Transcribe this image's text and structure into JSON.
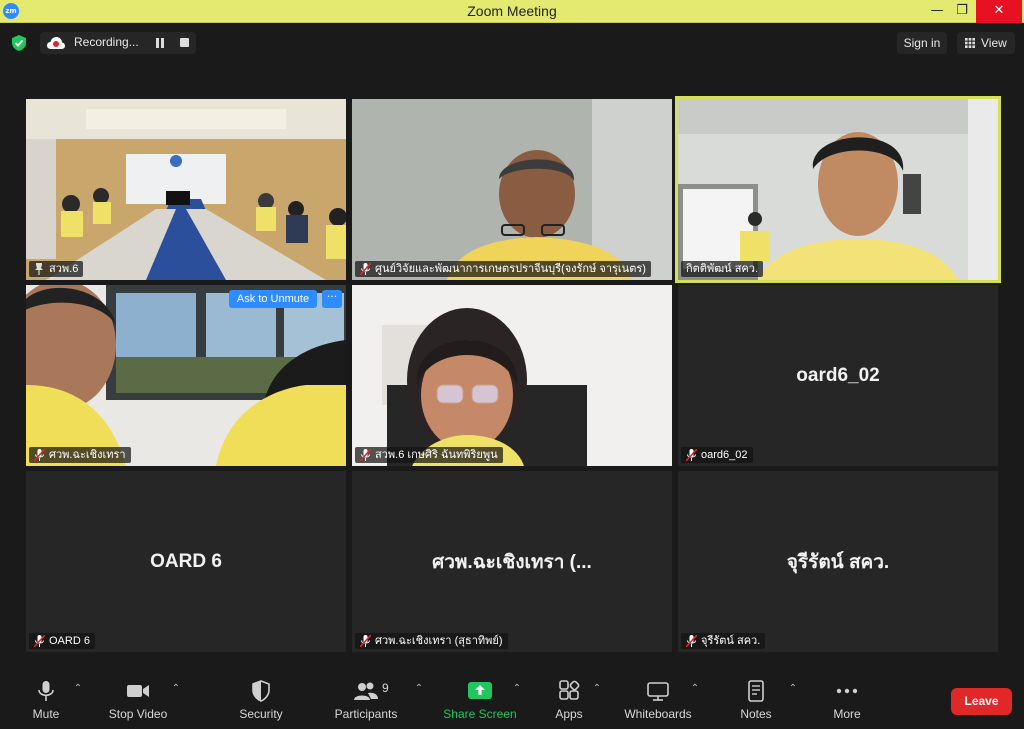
{
  "window": {
    "title": "Zoom Meeting",
    "logo_text": "zm",
    "minimize": "—",
    "maximize": "❐",
    "close": "✕"
  },
  "topbar": {
    "recording_label": "Recording...",
    "signin_label": "Sign in",
    "view_label": "View"
  },
  "tiles": [
    {
      "name": "สวพ.6",
      "icon": "pin-icon",
      "type": "video",
      "center": ""
    },
    {
      "name": "ศูนย์วิจัยและพัฒนาการเกษตรปราจีนบุรี(จงรักษ์ จารุเนตร)",
      "icon": "mic-off-icon",
      "type": "video",
      "center": ""
    },
    {
      "name": "กิตติพัฒน์ สคว.",
      "icon": "",
      "type": "video",
      "center": "",
      "active": true
    },
    {
      "name": "ศวพ.ฉะเชิงเทรา",
      "icon": "mic-off-icon",
      "type": "video",
      "center": "",
      "ask_unmute": "Ask to Unmute",
      "more": "···"
    },
    {
      "name": "สวพ.6 เกษศิริ ฉันทพิริยพูน",
      "icon": "mic-off-icon",
      "type": "video",
      "center": ""
    },
    {
      "name": "oard6_02",
      "icon": "mic-off-icon",
      "type": "name",
      "center": "oard6_02"
    },
    {
      "name": "OARD 6",
      "icon": "mic-off-icon",
      "type": "name",
      "center": "OARD 6"
    },
    {
      "name": "ศวพ.ฉะเชิงเทรา (สุธาทิพย์)",
      "icon": "mic-off-icon",
      "type": "name",
      "center": "ศวพ.ฉะเชิงเทรา (..."
    },
    {
      "name": "จุรีรัตน์ สคว.",
      "icon": "mic-off-icon",
      "type": "name",
      "center": "จุรีรัตน์ สคว."
    }
  ],
  "toolbar": {
    "mute": "Mute",
    "stop_video": "Stop Video",
    "security": "Security",
    "participants": "Participants",
    "participants_count": "9",
    "share_screen": "Share Screen",
    "apps": "Apps",
    "whiteboards": "Whiteboards",
    "notes": "Notes",
    "more": "More",
    "leave": "Leave"
  },
  "colors": {
    "accent": "#2d8cff",
    "active_speaker": "#d5e05a",
    "share_green": "#22c55e",
    "leave_red": "#e02828",
    "titlebar": "#e4ea6f"
  }
}
